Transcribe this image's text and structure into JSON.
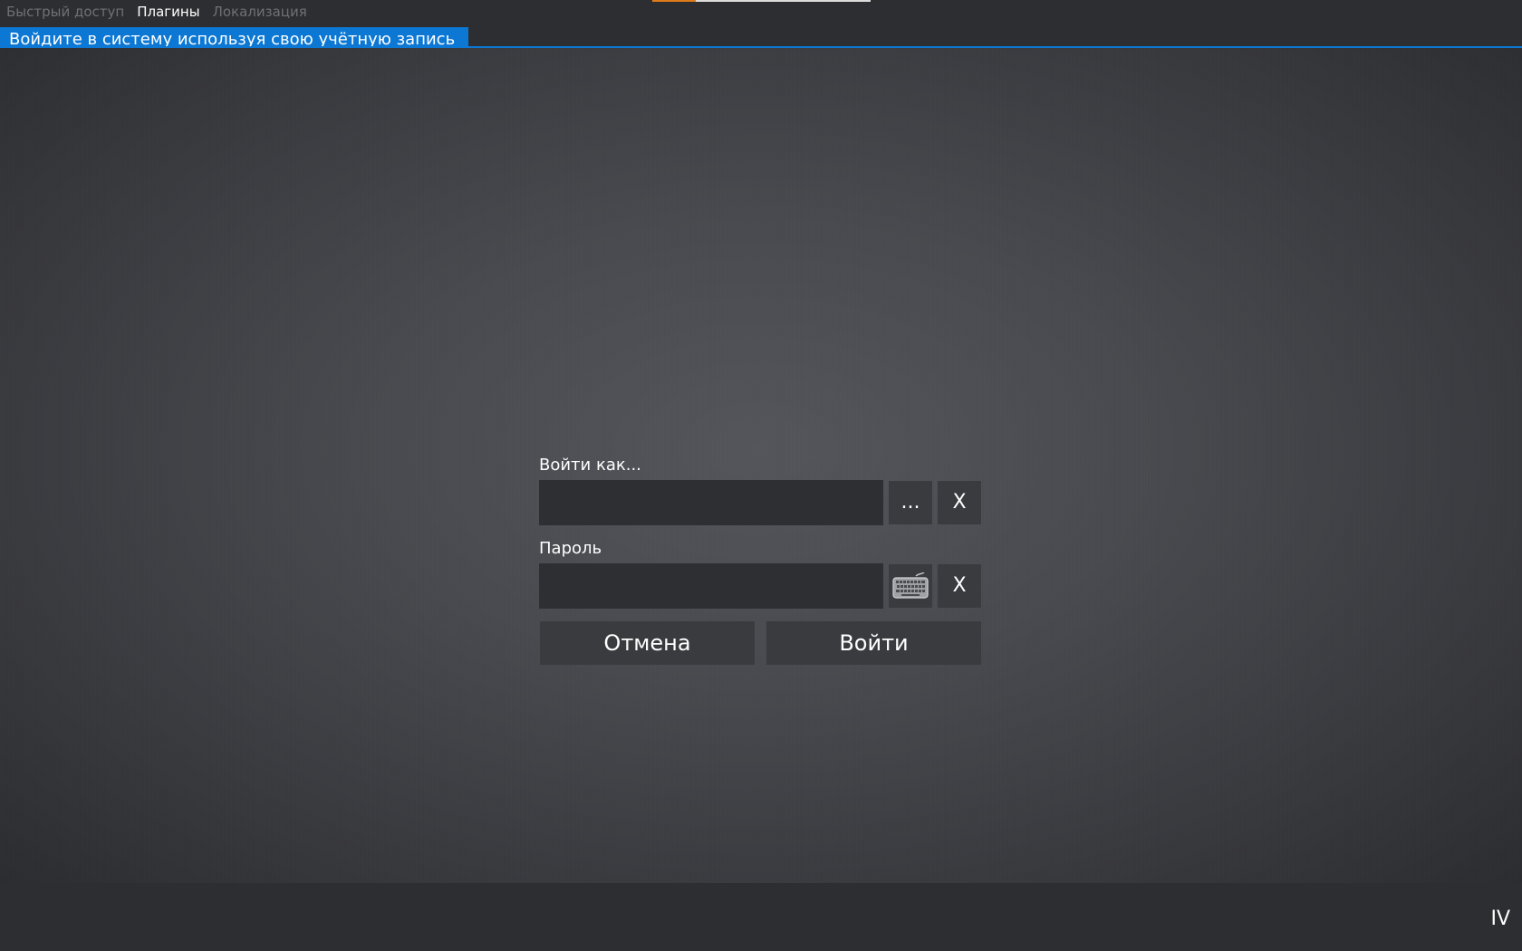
{
  "menu": {
    "items": [
      {
        "label": "Быстрый доступ",
        "active": false
      },
      {
        "label": "Плагины",
        "active": true
      },
      {
        "label": "Локализация",
        "active": false
      }
    ]
  },
  "header": {
    "title": "Войдите в систему используя свою учётную запись"
  },
  "login": {
    "username_label": "Войти как...",
    "username_value": "",
    "browse_label": "...",
    "clear_username_label": "X",
    "password_label": "Пароль",
    "password_value": "",
    "keyboard_icon": "keyboard-icon",
    "clear_password_label": "X",
    "cancel_label": "Отмена",
    "submit_label": "Войти"
  },
  "footer": {
    "version": "IV"
  },
  "colors": {
    "accent": "#0c78d4",
    "progress": "#e07b1a",
    "background": "#2d2e31"
  }
}
